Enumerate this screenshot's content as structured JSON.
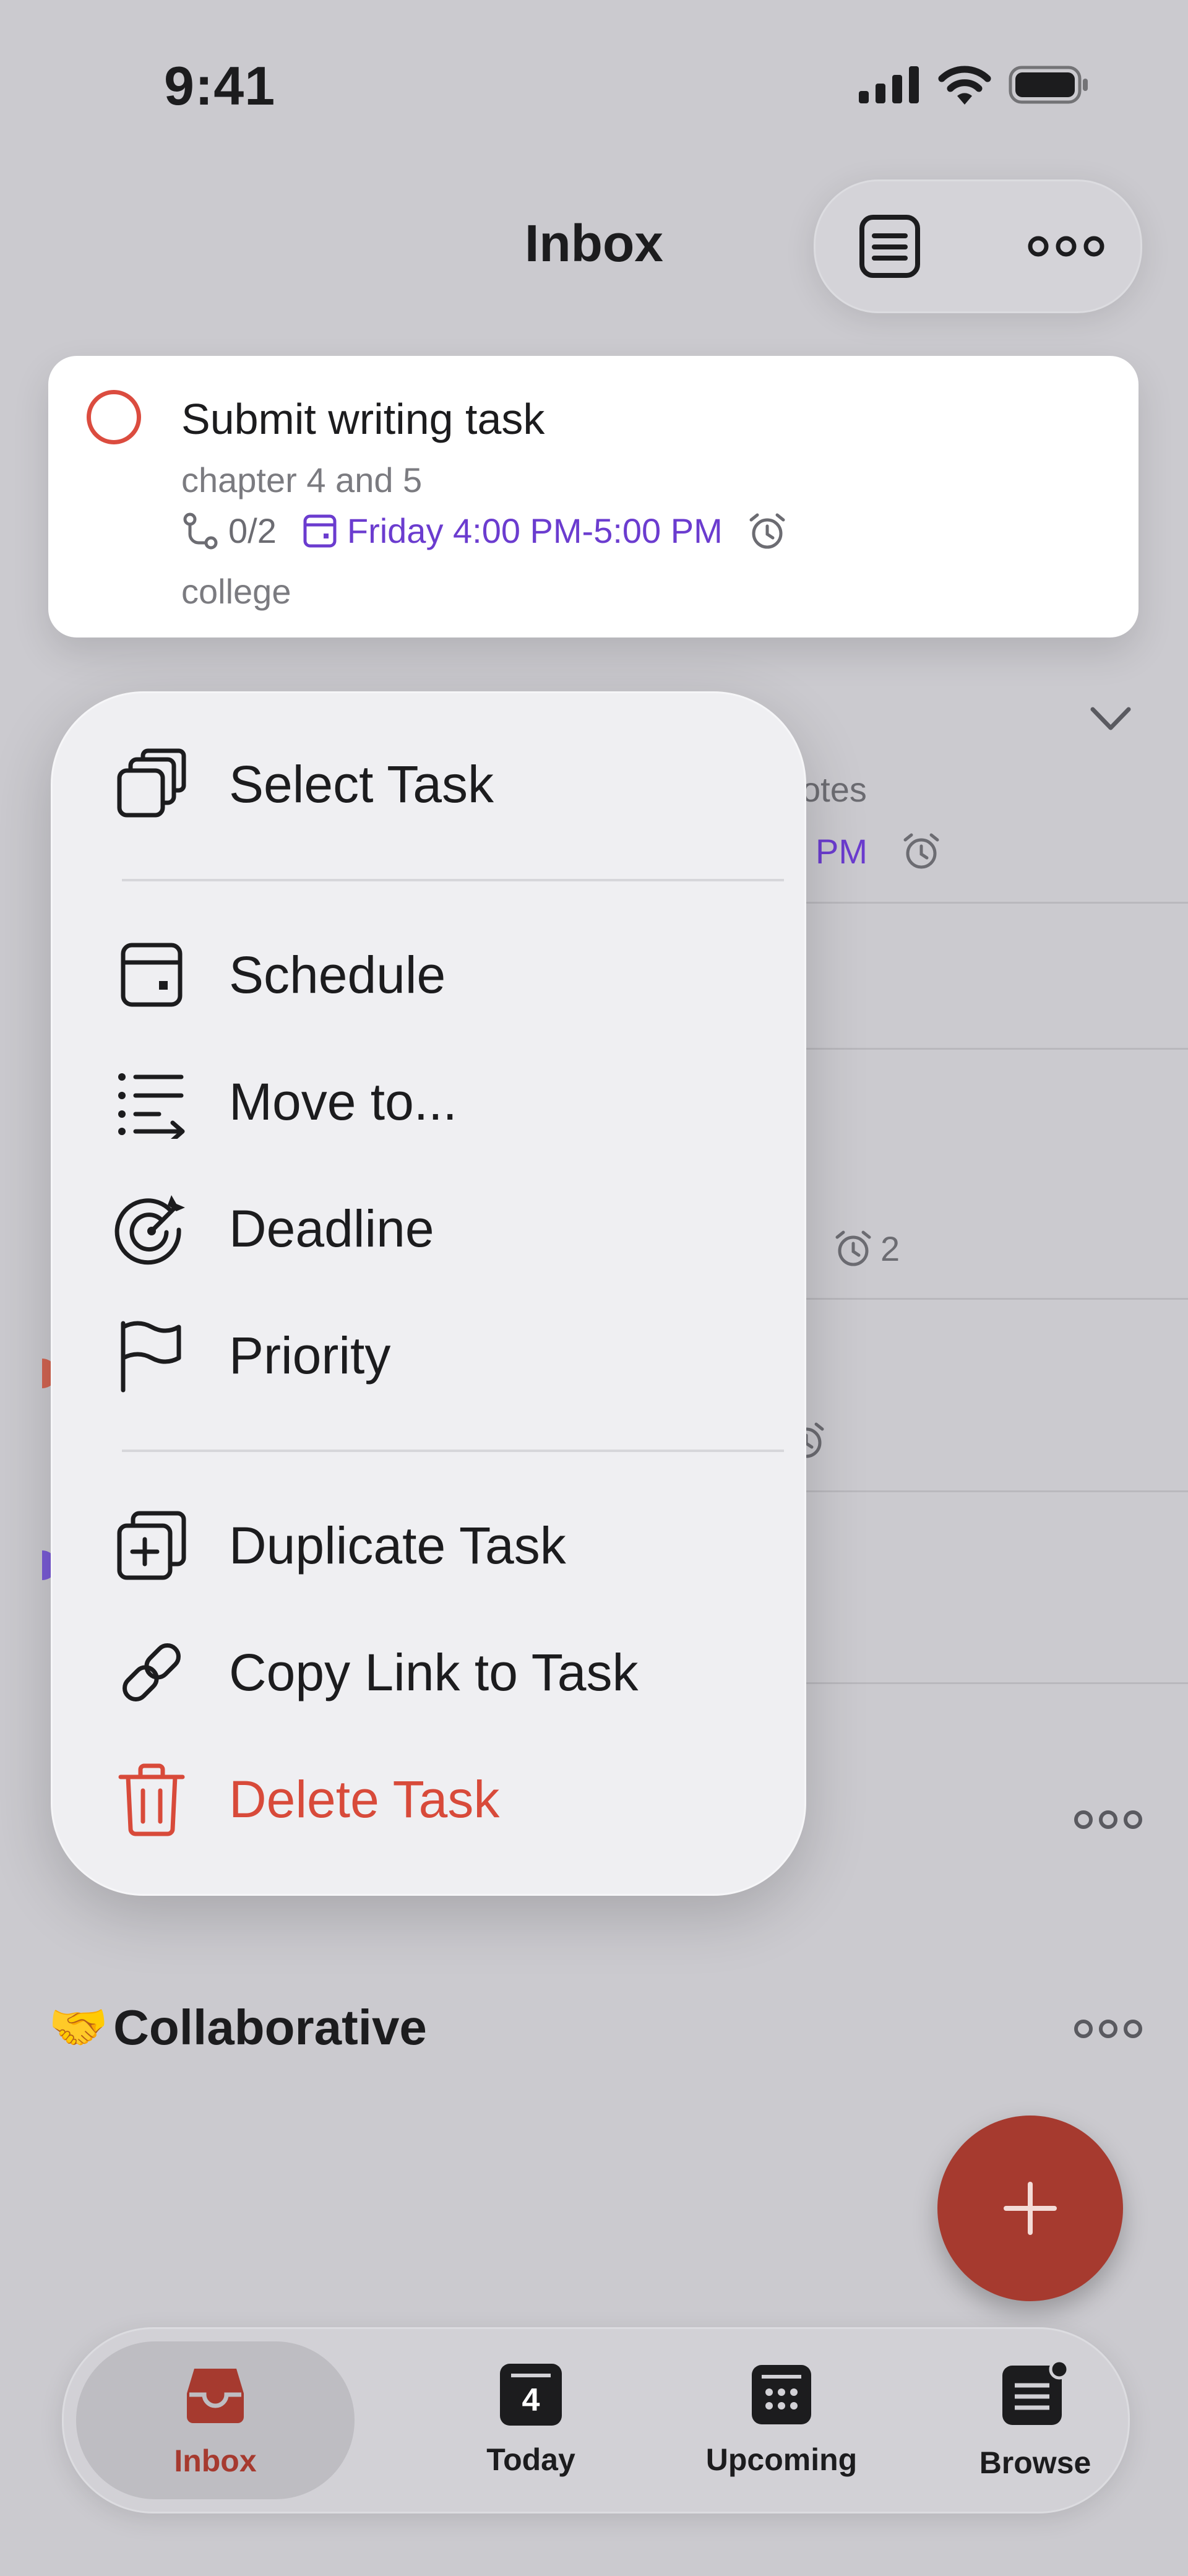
{
  "status_bar": {
    "time": "9:41"
  },
  "header": {
    "title": "Inbox"
  },
  "task": {
    "title": "Submit writing task",
    "description": "chapter 4 and 5",
    "subtasks": "0/2",
    "date": "Friday 4:00 PM-5:00 PM",
    "label": "college"
  },
  "background_fragments": {
    "notes": "otes",
    "time_suffix": "PM",
    "reminders": "2"
  },
  "menu": {
    "select": "Select Task",
    "schedule": "Schedule",
    "move": "Move to...",
    "deadline": "Deadline",
    "priority": "Priority",
    "duplicate": "Duplicate Task",
    "copy_link": "Copy Link to Task",
    "delete": "Delete Task"
  },
  "projects": {
    "collaborative": "Collaborative",
    "collaborative_emoji": "🤝"
  },
  "tabs": {
    "inbox": "Inbox",
    "today": "Today",
    "today_day": "4",
    "upcoming": "Upcoming",
    "browse": "Browse"
  },
  "colors": {
    "accent": "#db4c3f",
    "purple": "#6b3ccf",
    "delete": "#d84a3a"
  }
}
